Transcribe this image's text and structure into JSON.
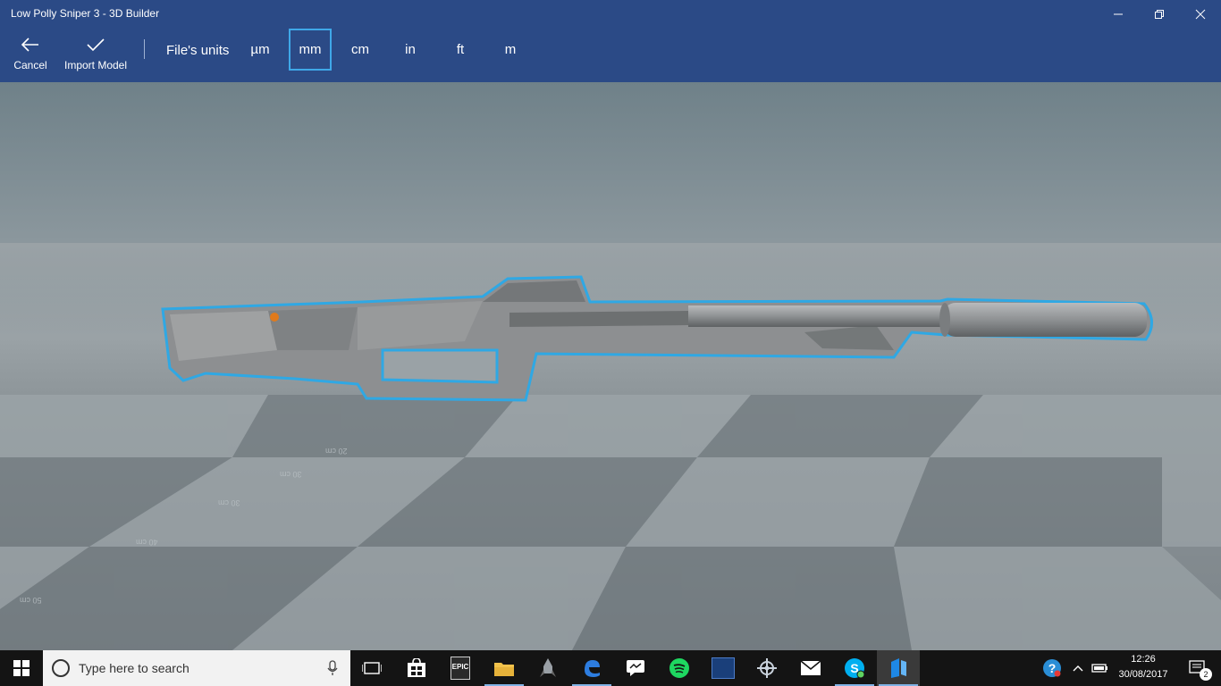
{
  "window": {
    "title": "Low Polly Sniper 3 - 3D Builder"
  },
  "window_controls": {
    "minimize": "—",
    "maximize": "❐",
    "close": "✕"
  },
  "toolbar": {
    "cancel_label": "Cancel",
    "import_label": "Import Model",
    "units_label": "File's units",
    "units": [
      "µm",
      "mm",
      "cm",
      "in",
      "ft",
      "m"
    ],
    "selected_unit": "mm"
  },
  "viewport": {
    "floor_labels": [
      "20 cm",
      "30 cm",
      "40 cm",
      "50 cm"
    ],
    "outline_color": "#2fa8e4",
    "model_color": "#8d8f91"
  },
  "taskbar": {
    "search_placeholder": "Type here to search",
    "epic_label": "EPIC",
    "apps": [
      "task-view",
      "store",
      "epic-games",
      "file-explorer",
      "rocket-game",
      "edge",
      "messaging",
      "spotify",
      "battle-net",
      "world-of-warships",
      "mail",
      "skype",
      "3d-builder"
    ],
    "active_apps": [
      "file-explorer",
      "edge",
      "skype",
      "3d-builder"
    ],
    "time": "12:26",
    "date": "30/08/2017",
    "notification_count": "2"
  }
}
